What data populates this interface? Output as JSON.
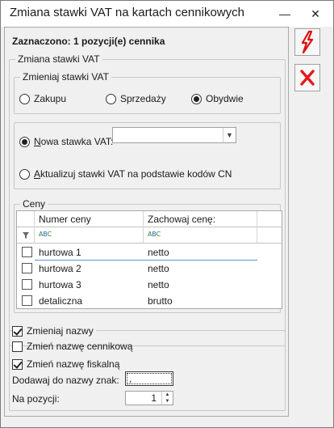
{
  "window": {
    "title": "Zmiana stawki VAT na kartach cennikowych",
    "minimize": "—",
    "close": "✕"
  },
  "info": {
    "selected": "Zaznaczono: 1 pozycji(e) cennika"
  },
  "vat_group": {
    "label": "Zmiana stawki VAT",
    "change_rates": {
      "label": "Zmieniaj stawki VAT",
      "options": [
        {
          "label": "Zakupu",
          "checked": false
        },
        {
          "label": "Sprzedaży",
          "checked": false
        },
        {
          "label": "Obydwie",
          "checked": true
        }
      ]
    },
    "new_rate": {
      "label_prefix": "N",
      "label_rest": "owa stawka VAT:",
      "checked": true,
      "value": ""
    },
    "update": {
      "label_prefix": "A",
      "label_rest": "ktualizuj stawki VAT na podstawie kodów CN",
      "checked": false
    },
    "prices": {
      "label": "Ceny",
      "columns": [
        "Numer ceny",
        "Zachowaj cenę:"
      ],
      "filter_icon": "funnel-icon",
      "abc_icon": "abc-filter-icon",
      "rows": [
        {
          "name": "hurtowa 1",
          "keep": "netto",
          "checked": false
        },
        {
          "name": "hurtowa 2",
          "keep": "netto",
          "checked": false
        },
        {
          "name": "hurtowa 3",
          "keep": "netto",
          "checked": false
        },
        {
          "name": "detaliczna",
          "keep": "brutto",
          "checked": false
        }
      ]
    }
  },
  "names_group": {
    "change_names": {
      "label": "Zmieniaj nazwy",
      "checked": true
    },
    "price_list_name": {
      "label": "Zmień nazwę cennikową",
      "checked": false
    },
    "fiscal_name": {
      "label": "Zmień nazwę fiskalną",
      "checked": true
    },
    "add_char_label": "Dodawaj do nazwy znak:",
    "add_char_value": ",",
    "position_label": "Na pozycji:",
    "position_value": "1"
  },
  "actions": {
    "run_icon": "lightning-icon",
    "cancel_icon": "red-x-icon"
  }
}
